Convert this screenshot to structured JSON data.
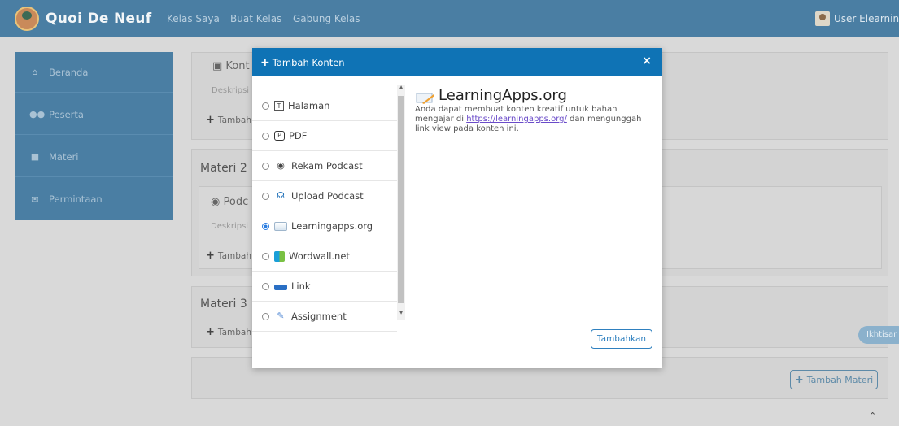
{
  "navbar": {
    "brand": "Quoi De Neuf",
    "links": [
      "Kelas Saya",
      "Buat Kelas",
      "Gabung Kelas"
    ],
    "user": "User Elearning"
  },
  "sidebar": {
    "items": [
      {
        "label": "Beranda",
        "icon": "home-icon"
      },
      {
        "label": "Peserta",
        "icon": "users-icon"
      },
      {
        "label": "Materi",
        "icon": "materials-icon"
      },
      {
        "label": "Permintaan",
        "icon": "mail-icon"
      }
    ]
  },
  "main": {
    "content_title_1": "Kont",
    "content_desc_1": "Deskripsi",
    "add_label": "Tambah",
    "materi_2": "Materi 2",
    "content_title_2": "Podc",
    "content_desc_2": "Deskripsi",
    "materi_3": "Materi 3",
    "add_materi": "Tambah Materi",
    "ikhtisar": "Ikhtisar"
  },
  "modal": {
    "title": "Tambah Konten",
    "close": "×",
    "options": [
      {
        "label": "Halaman",
        "icon": "page-icon",
        "selected": false
      },
      {
        "label": "PDF",
        "icon": "pdf-icon",
        "selected": false
      },
      {
        "label": "Rekam Podcast",
        "icon": "microphone-icon",
        "selected": false
      },
      {
        "label": "Upload Podcast",
        "icon": "headset-icon",
        "selected": false
      },
      {
        "label": "Learningapps.org",
        "icon": "learningapps-icon",
        "selected": true
      },
      {
        "label": "Wordwall.net",
        "icon": "wordwall-icon",
        "selected": false
      },
      {
        "label": "Link",
        "icon": "link-icon",
        "selected": false
      },
      {
        "label": "Assignment",
        "icon": "assignment-icon",
        "selected": false
      }
    ],
    "detail": {
      "title": "LearningApps.org",
      "desc_before": "Anda dapat membuat konten kreatif untuk bahan mengajar di ",
      "link": "https://learningapps.org/",
      "desc_after": " dan mengunggah link view pada konten ini."
    },
    "submit": "Tambahkan"
  },
  "colors": {
    "navbar": "#4a7ea3",
    "modal_header": "#0f73b5",
    "accent": "#2f80bf"
  }
}
